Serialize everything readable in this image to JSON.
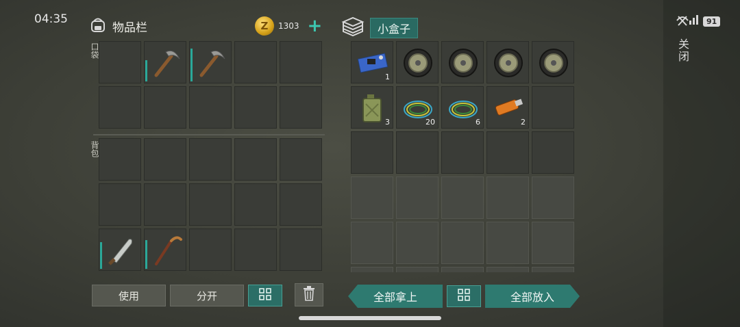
{
  "status_bar": {
    "time": "04:35",
    "battery": "91"
  },
  "sidebar": {
    "close_label": "关闭"
  },
  "inventory": {
    "title": "物品栏",
    "currency": {
      "symbol": "Z",
      "amount": "1303",
      "add_label": "+"
    },
    "pocket_label": "口袋",
    "backpack_label": "背包",
    "pocket_slots": [
      {
        "item": ""
      },
      {
        "item": "pickaxe-icon",
        "durability": 0.55
      },
      {
        "item": "pickaxe-icon",
        "durability": 0.85
      },
      {
        "item": ""
      },
      {
        "item": ""
      },
      {
        "item": ""
      },
      {
        "item": ""
      },
      {
        "item": ""
      },
      {
        "item": ""
      },
      {
        "item": ""
      }
    ],
    "backpack_slots": [
      {
        "item": ""
      },
      {
        "item": ""
      },
      {
        "item": ""
      },
      {
        "item": ""
      },
      {
        "item": ""
      },
      {
        "item": ""
      },
      {
        "item": ""
      },
      {
        "item": ""
      },
      {
        "item": ""
      },
      {
        "item": ""
      },
      {
        "item": "machete-icon",
        "durability": 0.7
      },
      {
        "item": "hockey-stick-icon",
        "durability": 0.75
      },
      {
        "item": ""
      },
      {
        "item": ""
      },
      {
        "item": ""
      }
    ],
    "buttons": {
      "use": "使用",
      "split": "分开",
      "sort_icon": "grid-icon",
      "trash_icon": "trash-icon"
    }
  },
  "container": {
    "title": "小盒子",
    "icon": "box-icon",
    "slots": [
      {
        "item": "circuit-board-icon",
        "qty": "1"
      },
      {
        "item": "wheel-icon",
        "qty": ""
      },
      {
        "item": "wheel-icon",
        "qty": ""
      },
      {
        "item": "wheel-icon",
        "qty": ""
      },
      {
        "item": "wheel-icon",
        "qty": ""
      },
      {
        "item": "jerrycan-icon",
        "qty": "3"
      },
      {
        "item": "wire-icon",
        "qty": "20"
      },
      {
        "item": "wire-icon",
        "qty": "6"
      },
      {
        "item": "usb-drive-icon",
        "qty": "2"
      },
      {
        "item": "",
        "qty": ""
      },
      {
        "item": "",
        "qty": ""
      },
      {
        "item": "",
        "qty": ""
      },
      {
        "item": "",
        "qty": ""
      },
      {
        "item": "",
        "qty": ""
      },
      {
        "item": "",
        "qty": ""
      }
    ],
    "buttons": {
      "take_all": "全部拿上",
      "sort_icon": "grid-icon",
      "put_all": "全部放入"
    }
  }
}
